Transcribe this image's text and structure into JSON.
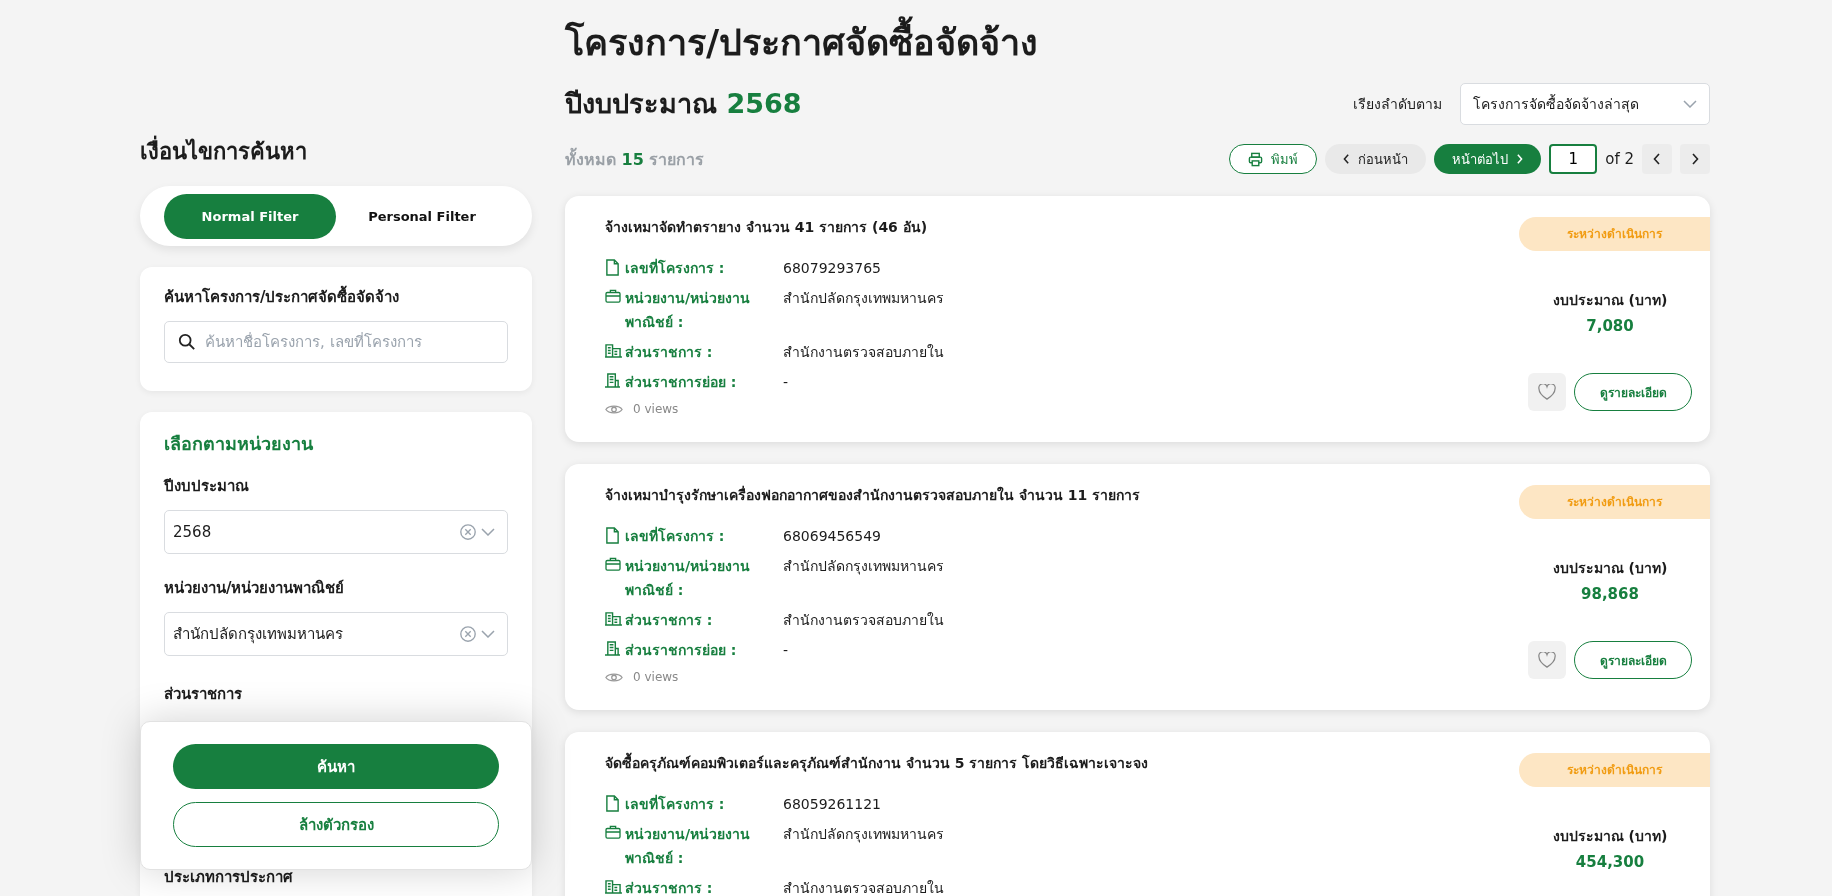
{
  "page_title": "โครงการ/ประกาศจัดซื้อจัดจ้าง",
  "fiscal_year": {
    "label": "ปีงบประมาณ",
    "value": "2568"
  },
  "sort": {
    "label": "เรียงลำดับตาม",
    "value": "โครงการจัดซื้อจัดจ้างล่าสุด"
  },
  "total": {
    "prefix": "ทั้งหมด",
    "count": "15",
    "suffix": "รายการ"
  },
  "toolbar": {
    "print": "พิมพ์",
    "prev": "ก่อนหน้า",
    "next": "หน้าต่อไป",
    "page": "1",
    "of": "of 2"
  },
  "filters": {
    "title": "เงื่อนไขการค้นหา",
    "tabs": [
      {
        "label": "Normal Filter",
        "selected": true
      },
      {
        "label": "Personal Filter",
        "selected": false
      }
    ],
    "search": {
      "label": "ค้นหาโครงการ/ประกาศจัดซื้อจัดจ้าง",
      "placeholder": "ค้นหาชื่อโครงการ, เลขที่โครงการ"
    },
    "section_title": "เลือกตามหน่วยงาน",
    "selects": [
      {
        "label": "ปีงบประมาณ",
        "value": "2568"
      },
      {
        "label": "หน่วยงาน/หน่วยงานพาณิชย์",
        "value": "สำนักปลัดกรุงเทพมหานคร"
      }
    ],
    "more_labels": [
      "ส่วนราชการ",
      "ประเภทการประกาศ"
    ],
    "search_button": "ค้นหา",
    "clear_button": "ล้างตัวกรอง"
  },
  "projects": [
    {
      "title": "จ้างเหมาจัดทำตรายาง จำนวน 41 รายการ (46 อัน)",
      "status": "ระหว่างดำเนินการ",
      "fields": [
        {
          "kind": "doc",
          "label": "เลขที่โครงการ :",
          "value": "68079293765"
        },
        {
          "kind": "org",
          "label": "หน่วยงาน/หน่วยงาน พาณิชย์ :",
          "value": "สำนักปลัดกรุงเทพมหานคร"
        },
        {
          "kind": "building",
          "label": "ส่วนราชการ :",
          "value": "สำนักงานตรวจสอบภายใน"
        },
        {
          "kind": "sub",
          "label": "ส่วนราชการย่อย :",
          "value": "-"
        }
      ],
      "views": "0 views",
      "budget_label": "งบประมาณ (บาท)",
      "budget": "7,080",
      "detail": "ดูรายละเอียด"
    },
    {
      "title": "จ้างเหมาบำรุงรักษาเครื่องฟอกอากาศของสำนักงานตรวจสอบภายใน จำนวน 11 รายการ",
      "status": "ระหว่างดำเนินการ",
      "fields": [
        {
          "kind": "doc",
          "label": "เลขที่โครงการ :",
          "value": "68069456549"
        },
        {
          "kind": "org",
          "label": "หน่วยงาน/หน่วยงาน พาณิชย์ :",
          "value": "สำนักปลัดกรุงเทพมหานคร"
        },
        {
          "kind": "building",
          "label": "ส่วนราชการ :",
          "value": "สำนักงานตรวจสอบภายใน"
        },
        {
          "kind": "sub",
          "label": "ส่วนราชการย่อย :",
          "value": "-"
        }
      ],
      "views": "0 views",
      "budget_label": "งบประมาณ (บาท)",
      "budget": "98,868",
      "detail": "ดูรายละเอียด"
    },
    {
      "title": "จัดซื้อครุภัณฑ์คอมพิวเตอร์และครุภัณฑ์สำนักงาน จำนวน 5 รายการ โดยวิธีเฉพาะเจาะจง",
      "status": "ระหว่างดำเนินการ",
      "fields": [
        {
          "kind": "doc",
          "label": "เลขที่โครงการ :",
          "value": "68059261121"
        },
        {
          "kind": "org",
          "label": "หน่วยงาน/หน่วยงาน พาณิชย์ :",
          "value": "สำนักปลัดกรุงเทพมหานคร"
        },
        {
          "kind": "building",
          "label": "ส่วนราชการ :",
          "value": "สำนักงานตรวจสอบภายใน"
        }
      ],
      "budget_label": "งบประมาณ (บาท)",
      "budget": "454,300"
    }
  ]
}
